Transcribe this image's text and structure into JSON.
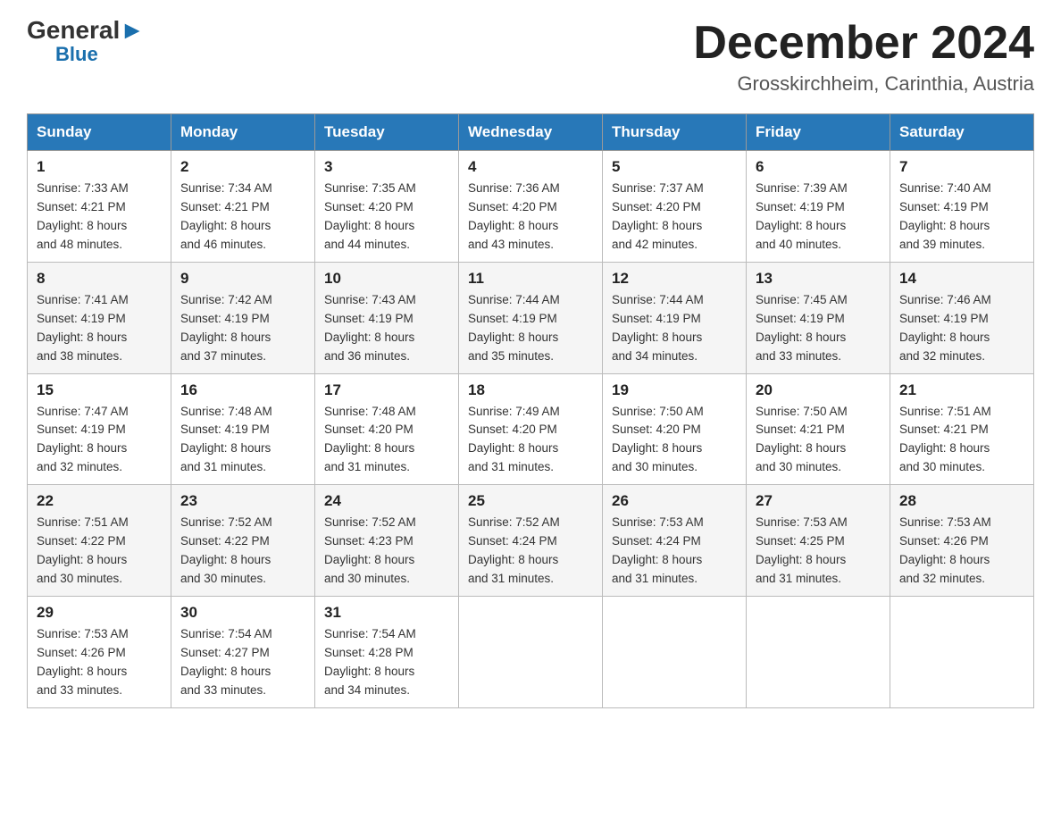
{
  "header": {
    "logo_general": "General",
    "logo_blue": "Blue",
    "month_title": "December 2024",
    "subtitle": "Grosskirchheim, Carinthia, Austria"
  },
  "days_of_week": [
    "Sunday",
    "Monday",
    "Tuesday",
    "Wednesday",
    "Thursday",
    "Friday",
    "Saturday"
  ],
  "weeks": [
    [
      {
        "day": "1",
        "sunrise": "7:33 AM",
        "sunset": "4:21 PM",
        "daylight": "8 hours and 48 minutes."
      },
      {
        "day": "2",
        "sunrise": "7:34 AM",
        "sunset": "4:21 PM",
        "daylight": "8 hours and 46 minutes."
      },
      {
        "day": "3",
        "sunrise": "7:35 AM",
        "sunset": "4:20 PM",
        "daylight": "8 hours and 44 minutes."
      },
      {
        "day": "4",
        "sunrise": "7:36 AM",
        "sunset": "4:20 PM",
        "daylight": "8 hours and 43 minutes."
      },
      {
        "day": "5",
        "sunrise": "7:37 AM",
        "sunset": "4:20 PM",
        "daylight": "8 hours and 42 minutes."
      },
      {
        "day": "6",
        "sunrise": "7:39 AM",
        "sunset": "4:19 PM",
        "daylight": "8 hours and 40 minutes."
      },
      {
        "day": "7",
        "sunrise": "7:40 AM",
        "sunset": "4:19 PM",
        "daylight": "8 hours and 39 minutes."
      }
    ],
    [
      {
        "day": "8",
        "sunrise": "7:41 AM",
        "sunset": "4:19 PM",
        "daylight": "8 hours and 38 minutes."
      },
      {
        "day": "9",
        "sunrise": "7:42 AM",
        "sunset": "4:19 PM",
        "daylight": "8 hours and 37 minutes."
      },
      {
        "day": "10",
        "sunrise": "7:43 AM",
        "sunset": "4:19 PM",
        "daylight": "8 hours and 36 minutes."
      },
      {
        "day": "11",
        "sunrise": "7:44 AM",
        "sunset": "4:19 PM",
        "daylight": "8 hours and 35 minutes."
      },
      {
        "day": "12",
        "sunrise": "7:44 AM",
        "sunset": "4:19 PM",
        "daylight": "8 hours and 34 minutes."
      },
      {
        "day": "13",
        "sunrise": "7:45 AM",
        "sunset": "4:19 PM",
        "daylight": "8 hours and 33 minutes."
      },
      {
        "day": "14",
        "sunrise": "7:46 AM",
        "sunset": "4:19 PM",
        "daylight": "8 hours and 32 minutes."
      }
    ],
    [
      {
        "day": "15",
        "sunrise": "7:47 AM",
        "sunset": "4:19 PM",
        "daylight": "8 hours and 32 minutes."
      },
      {
        "day": "16",
        "sunrise": "7:48 AM",
        "sunset": "4:19 PM",
        "daylight": "8 hours and 31 minutes."
      },
      {
        "day": "17",
        "sunrise": "7:48 AM",
        "sunset": "4:20 PM",
        "daylight": "8 hours and 31 minutes."
      },
      {
        "day": "18",
        "sunrise": "7:49 AM",
        "sunset": "4:20 PM",
        "daylight": "8 hours and 31 minutes."
      },
      {
        "day": "19",
        "sunrise": "7:50 AM",
        "sunset": "4:20 PM",
        "daylight": "8 hours and 30 minutes."
      },
      {
        "day": "20",
        "sunrise": "7:50 AM",
        "sunset": "4:21 PM",
        "daylight": "8 hours and 30 minutes."
      },
      {
        "day": "21",
        "sunrise": "7:51 AM",
        "sunset": "4:21 PM",
        "daylight": "8 hours and 30 minutes."
      }
    ],
    [
      {
        "day": "22",
        "sunrise": "7:51 AM",
        "sunset": "4:22 PM",
        "daylight": "8 hours and 30 minutes."
      },
      {
        "day": "23",
        "sunrise": "7:52 AM",
        "sunset": "4:22 PM",
        "daylight": "8 hours and 30 minutes."
      },
      {
        "day": "24",
        "sunrise": "7:52 AM",
        "sunset": "4:23 PM",
        "daylight": "8 hours and 30 minutes."
      },
      {
        "day": "25",
        "sunrise": "7:52 AM",
        "sunset": "4:24 PM",
        "daylight": "8 hours and 31 minutes."
      },
      {
        "day": "26",
        "sunrise": "7:53 AM",
        "sunset": "4:24 PM",
        "daylight": "8 hours and 31 minutes."
      },
      {
        "day": "27",
        "sunrise": "7:53 AM",
        "sunset": "4:25 PM",
        "daylight": "8 hours and 31 minutes."
      },
      {
        "day": "28",
        "sunrise": "7:53 AM",
        "sunset": "4:26 PM",
        "daylight": "8 hours and 32 minutes."
      }
    ],
    [
      {
        "day": "29",
        "sunrise": "7:53 AM",
        "sunset": "4:26 PM",
        "daylight": "8 hours and 33 minutes."
      },
      {
        "day": "30",
        "sunrise": "7:54 AM",
        "sunset": "4:27 PM",
        "daylight": "8 hours and 33 minutes."
      },
      {
        "day": "31",
        "sunrise": "7:54 AM",
        "sunset": "4:28 PM",
        "daylight": "8 hours and 34 minutes."
      },
      null,
      null,
      null,
      null
    ]
  ],
  "labels": {
    "sunrise": "Sunrise:",
    "sunset": "Sunset:",
    "daylight": "Daylight:"
  }
}
